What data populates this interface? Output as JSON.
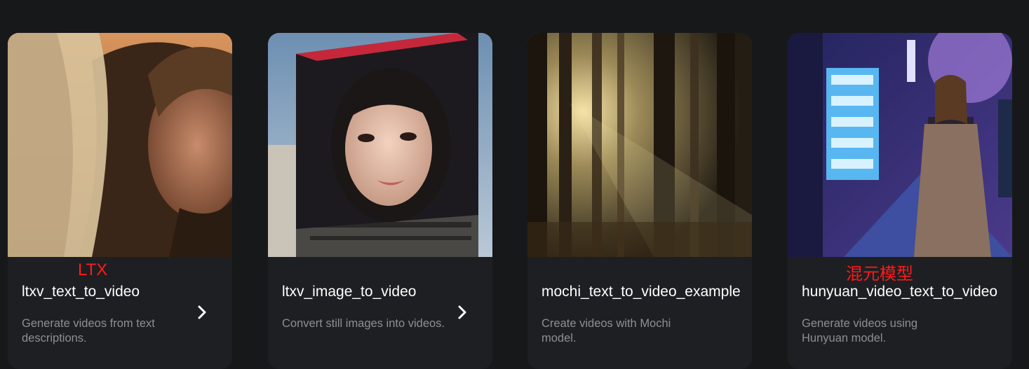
{
  "cards": [
    {
      "annotation": "LTX",
      "title": "ltxv_text_to_video",
      "description": "Generate videos from text descriptions.",
      "action_icon": "chevron-right-icon"
    },
    {
      "annotation": "",
      "title": "ltxv_image_to_video",
      "description": "Convert still images into videos.",
      "action_icon": "chevron-right-icon"
    },
    {
      "annotation": "",
      "title": "mochi_text_to_video_example",
      "description": "Create videos with Mochi model."
    },
    {
      "annotation": "混元模型",
      "title": "hunyuan_video_text_to_video",
      "description": "Generate videos using Hunyuan model."
    }
  ],
  "colors": {
    "background": "#17181a",
    "card": "#1e1f22",
    "annotation": "#ff1a1a",
    "title": "#ffffff",
    "description": "#8c8f95"
  }
}
